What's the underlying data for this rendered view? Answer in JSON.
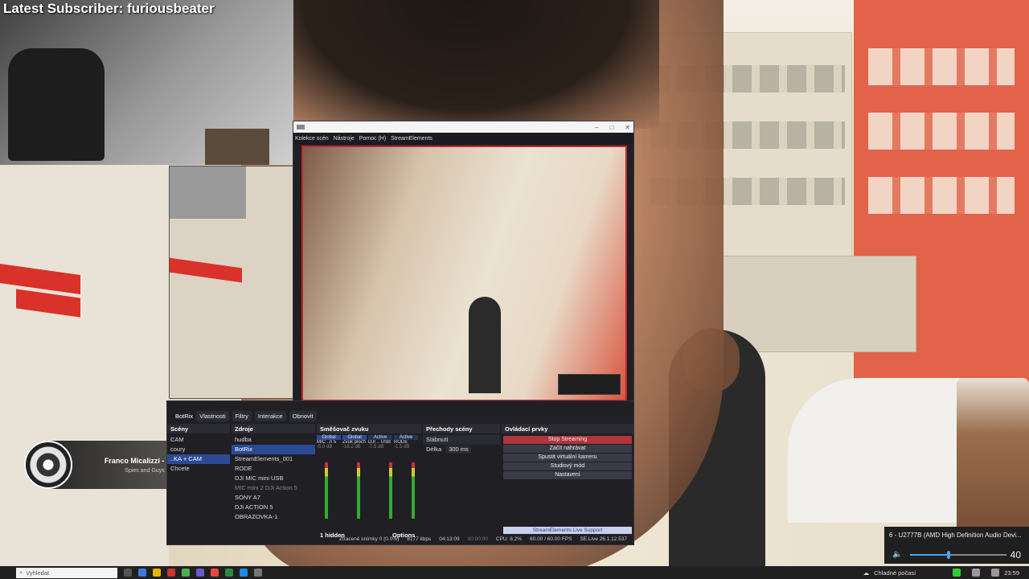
{
  "overlay": {
    "latest_subscriber": "Latest Subscriber: furiousbeater"
  },
  "now_playing": {
    "title": "Franco Micalizzi - Topic",
    "subtitle": "Spies and Guys"
  },
  "obs": {
    "menu": [
      "Kolekce scén",
      "Nástroje",
      "Pomoc (H)",
      "StreamElements"
    ],
    "toolbar": {
      "source_name": "BotRix",
      "properties": "Vlastnosti",
      "filters": "Filtry",
      "interact": "Interakce",
      "refresh": "Obnovit"
    },
    "scenes": {
      "header": "Scény",
      "items": [
        "CAM",
        "coury",
        "..KA + CAM",
        "Chcete"
      ]
    },
    "sources": {
      "header": "Zdroje",
      "items": [
        "hudba",
        "BotRix",
        "StreamElements_001",
        "RODE",
        "DJI MIC mini USB",
        "MIC mini 2 DJI Action 5",
        "SONY A7",
        "DJI ACTION 5",
        "OBRAZOVKA-1"
      ]
    },
    "mixer": {
      "header": "Směšovač zvuku",
      "channels": [
        {
          "name": "MIC ..n 5",
          "tag": "Global",
          "db": "-5.0 dB"
        },
        {
          "name": "Zvuk ploch",
          "tag": "Global",
          "db": "-16.2 dB"
        },
        {
          "name": "DJI .. USB",
          "tag": "Active",
          "db": "-7.5 dB"
        },
        {
          "name": "RODE",
          "tag": "Active",
          "db": "-1.5 dB"
        }
      ],
      "hidden": "1 hidden",
      "options": "Options"
    },
    "transitions": {
      "header": "Přechody scény",
      "type": "Slábnutí",
      "duration_label": "Délka",
      "duration": "300 ms"
    },
    "controls": {
      "header": "Ovládací prvky",
      "stop_streaming": "Stop Streaming",
      "start_recording": "Začít nahrávat",
      "virtual_camera": "Spustit virtuální kameru",
      "studio_mode": "Studiový mód",
      "settings": "Nastavení",
      "se_support": "StreamElements Live Support"
    },
    "status": {
      "dropped": "Ztracené snímky 0 (0.0%)",
      "bitrate": "8177 kbps",
      "live_time": "04:13:09",
      "rec_time": "00:00:00",
      "cpu": "CPU: 8.2%",
      "fps": "60.00 / 60.00 FPS",
      "version": "SE.Live 26.1.12.537"
    }
  },
  "volume_popup": {
    "device": "6 - U2777B (AMD High Definition Audio Devi...",
    "level": "40",
    "level_fraction": 0.4
  },
  "taskbar": {
    "search_placeholder": "Vyhledat",
    "weather": "Chladné počasí",
    "time": "23:59"
  }
}
